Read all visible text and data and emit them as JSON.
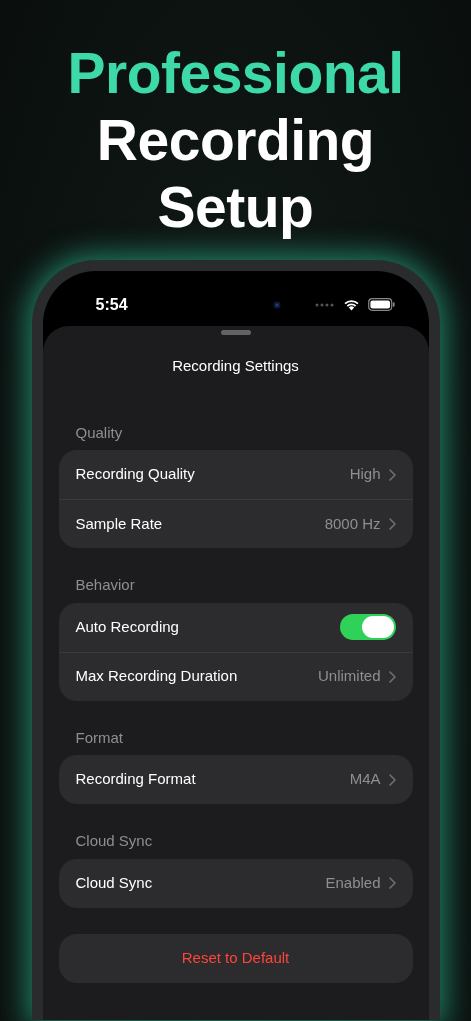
{
  "headline": {
    "accent": "Professional",
    "main": "Recording Setup"
  },
  "status_bar": {
    "time": "5:54"
  },
  "sheet": {
    "title": "Recording Settings"
  },
  "sections": [
    {
      "header": "Quality",
      "rows": [
        {
          "kind": "nav",
          "label": "Recording Quality",
          "value": "High"
        },
        {
          "kind": "nav",
          "label": "Sample Rate",
          "value": "8000 Hz"
        }
      ]
    },
    {
      "header": "Behavior",
      "rows": [
        {
          "kind": "toggle",
          "label": "Auto Recording",
          "on": true
        },
        {
          "kind": "nav",
          "label": "Max Recording Duration",
          "value": "Unlimited"
        }
      ]
    },
    {
      "header": "Format",
      "rows": [
        {
          "kind": "nav",
          "label": "Recording Format",
          "value": "M4A"
        }
      ]
    },
    {
      "header": "Cloud Sync",
      "rows": [
        {
          "kind": "nav",
          "label": "Cloud Sync",
          "value": "Enabled"
        }
      ]
    }
  ],
  "reset_button": "Reset to Default"
}
